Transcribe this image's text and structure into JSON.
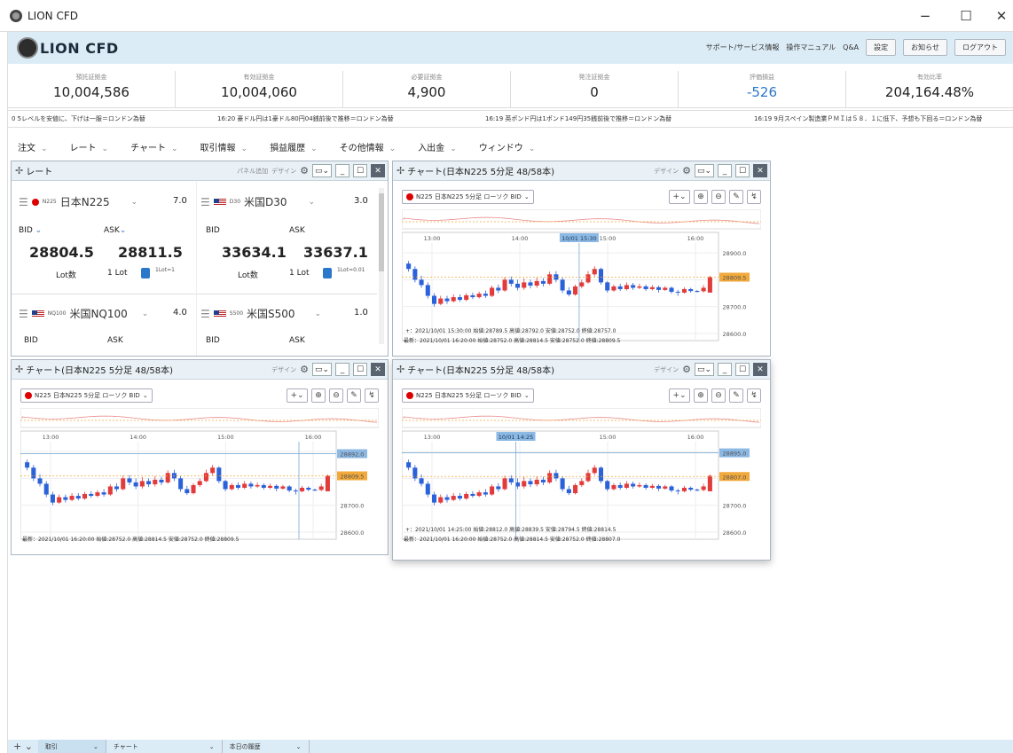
{
  "window": {
    "title": "LION CFD",
    "minimize": "−",
    "maximize": "☐",
    "close": "✕"
  },
  "header": {
    "brand": "LION CFD",
    "links": [
      "サポート/サービス情報",
      "操作マニュアル",
      "Q&A"
    ],
    "buttons": [
      "設定",
      "お知らせ",
      "ログアウト"
    ]
  },
  "summary": [
    {
      "label": "預託証拠金",
      "value": "10,004,586"
    },
    {
      "label": "有効証拠金",
      "value": "10,004,060"
    },
    {
      "label": "必要証拠金",
      "value": "4,900"
    },
    {
      "label": "発注証拠金",
      "value": "0"
    },
    {
      "label": "評価損益",
      "value": "-526"
    },
    {
      "label": "有効比率",
      "value": "204,164.48%"
    }
  ],
  "news": [
    "0 5レベルを安値に、下げは一服＝ロンドン為替",
    "16:20 豪ドル円は1豪ドル80円04銭前後で推移＝ロンドン為替",
    "16:19 英ポンド円は1ポンド149円35銭前後で推移＝ロンドン為替",
    "16:19 9月スペイン製造業ＰＭＩは５８．１に低下、予想も下回る＝ロンドン為替"
  ],
  "menu": [
    "注文",
    "レート",
    "チャート",
    "取引情報",
    "損益履歴",
    "その他情報",
    "入出金",
    "ウィンドウ"
  ],
  "rate_panel": {
    "title": "レート",
    "add_label": "パネル追加",
    "design_label": "デザイン",
    "cells": [
      {
        "code": "N225",
        "name": "日本N225",
        "spread": "7.0",
        "bid_label": "BID",
        "ask_label": "ASK",
        "bid": "28804.5",
        "ask": "28811.5",
        "lot_label": "Lot数",
        "lot": "1 Lot",
        "lot_unit": "1Lot=",
        "lot_unit_val": "1",
        "flag": "jp"
      },
      {
        "code": "D30",
        "name": "米国D30",
        "spread": "3.0",
        "bid_label": "BID",
        "ask_label": "ASK",
        "bid": "33634.1",
        "ask": "33637.1",
        "lot_label": "Lot数",
        "lot": "1 Lot",
        "lot_unit": "1Lot=",
        "lot_unit_val": "0.01",
        "flag": "us"
      },
      {
        "code": "NQ100",
        "name": "米国NQ100",
        "spread": "4.0",
        "bid_label": "BID",
        "ask_label": "ASK",
        "flag": "us"
      },
      {
        "code": "S500",
        "name": "米国S500",
        "spread": "1.0",
        "bid_label": "BID",
        "ask_label": "ASK",
        "flag": "us"
      }
    ]
  },
  "charts": [
    {
      "title": "チャート(日本N225 5分足 48/58本)",
      "design_label": "デザイン",
      "symbol_select": "N225 日本N225  5分足 ローソク BID",
      "times": [
        "13:00",
        "14:00",
        "15:00",
        "16:00"
      ],
      "cursor_time": "10/01 15:30",
      "prices": [
        "28900.0",
        "28809.5",
        "28700.0",
        "28600.0"
      ],
      "current_price": "28809.5",
      "crosshair_info": "+：2021/10/01 15:30:00 始値:28789.5 高値:28792.0 安値:28752.0 終値:28757.0",
      "latest_info": "最新：2021/10/01 16:20:00 始値:28752.0 高値:28814.5 安値:28752.0 終値:28809.5"
    },
    {
      "title": "チャート(日本N225 5分足 48/58本)",
      "design_label": "デザイン",
      "symbol_select": "N225 日本N225  5分足 ローソク BID",
      "times": [
        "13:00",
        "14:00",
        "15:00",
        "16:00"
      ],
      "prices": [
        "28892.0",
        "28809.5",
        "28700.0",
        "28600.0"
      ],
      "current_price": "28809.5",
      "line_price": "28892.0",
      "latest_info": "最新：2021/10/01 16:20:00 始値:28752.0 高値:28814.5 安値:28752.0 終値:28809.5"
    },
    {
      "title": "チャート(日本N225 5分足 48/58本)",
      "design_label": "デザイン",
      "symbol_select": "N225 日本N225  5分足 ローソク BID",
      "times": [
        "13:00",
        "14:",
        "15:00",
        "16:00"
      ],
      "cursor_time": "10/01 14:25",
      "prices": [
        "28895.0",
        "28807.0",
        "28700.0",
        "28600.0"
      ],
      "current_price": "28807.0",
      "line_price": "28895.0",
      "crosshair_info": "+：2021/10/01 14:25:00 始値:28812.0 高値:28839.5 安値:28794.5 終値:28814.5",
      "latest_info": "最新：2021/10/01 16:20:00 始値:28752.0 高値:28814.5 安値:28752.0 終値:28807.0"
    }
  ],
  "bottom_tabs": [
    "取引",
    "チャート",
    "本日の履歴"
  ],
  "colors": {
    "up": "#e23b3b",
    "down": "#2b62d9",
    "accent": "#2b77c9",
    "header_bg": "#dcecf6"
  },
  "candles": [
    {
      "o": 28860,
      "c": 28840,
      "h": 28870,
      "l": 28830
    },
    {
      "o": 28840,
      "c": 28800,
      "h": 28850,
      "l": 28790
    },
    {
      "o": 28800,
      "c": 28780,
      "h": 28815,
      "l": 28770
    },
    {
      "o": 28780,
      "c": 28740,
      "h": 28790,
      "l": 28730
    },
    {
      "o": 28740,
      "c": 28710,
      "h": 28750,
      "l": 28700
    },
    {
      "o": 28710,
      "c": 28730,
      "h": 28740,
      "l": 28705
    },
    {
      "o": 28730,
      "c": 28720,
      "h": 28740,
      "l": 28710
    },
    {
      "o": 28720,
      "c": 28735,
      "h": 28745,
      "l": 28715
    },
    {
      "o": 28735,
      "c": 28725,
      "h": 28745,
      "l": 28718
    },
    {
      "o": 28725,
      "c": 28742,
      "h": 28750,
      "l": 28720
    },
    {
      "o": 28742,
      "c": 28735,
      "h": 28752,
      "l": 28728
    },
    {
      "o": 28735,
      "c": 28748,
      "h": 28756,
      "l": 28730
    },
    {
      "o": 28748,
      "c": 28740,
      "h": 28760,
      "l": 28732
    },
    {
      "o": 28740,
      "c": 28770,
      "h": 28778,
      "l": 28735
    },
    {
      "o": 28770,
      "c": 28760,
      "h": 28782,
      "l": 28750
    },
    {
      "o": 28760,
      "c": 28800,
      "h": 28810,
      "l": 28755
    },
    {
      "o": 28800,
      "c": 28785,
      "h": 28812,
      "l": 28775
    },
    {
      "o": 28785,
      "c": 28770,
      "h": 28800,
      "l": 28760
    },
    {
      "o": 28770,
      "c": 28790,
      "h": 28805,
      "l": 28762
    },
    {
      "o": 28790,
      "c": 28778,
      "h": 28800,
      "l": 28768
    },
    {
      "o": 28778,
      "c": 28795,
      "h": 28808,
      "l": 28770
    },
    {
      "o": 28795,
      "c": 28785,
      "h": 28806,
      "l": 28775
    },
    {
      "o": 28785,
      "c": 28820,
      "h": 28830,
      "l": 28780
    },
    {
      "o": 28820,
      "c": 28800,
      "h": 28832,
      "l": 28790
    },
    {
      "o": 28800,
      "c": 28760,
      "h": 28808,
      "l": 28750
    },
    {
      "o": 28760,
      "c": 28745,
      "h": 28772,
      "l": 28738
    },
    {
      "o": 28745,
      "c": 28775,
      "h": 28782,
      "l": 28740
    },
    {
      "o": 28775,
      "c": 28790,
      "h": 28800,
      "l": 28768
    },
    {
      "o": 28790,
      "c": 28820,
      "h": 28832,
      "l": 28785
    },
    {
      "o": 28820,
      "c": 28840,
      "h": 28850,
      "l": 28812
    },
    {
      "o": 28840,
      "c": 28790,
      "h": 28845,
      "l": 28782
    },
    {
      "o": 28790,
      "c": 28760,
      "h": 28795,
      "l": 28752
    },
    {
      "o": 28760,
      "c": 28775,
      "h": 28782,
      "l": 28755
    },
    {
      "o": 28775,
      "c": 28765,
      "h": 28785,
      "l": 28758
    },
    {
      "o": 28765,
      "c": 28780,
      "h": 28790,
      "l": 28760
    },
    {
      "o": 28780,
      "c": 28770,
      "h": 28788,
      "l": 28762
    },
    {
      "o": 28770,
      "c": 28775,
      "h": 28785,
      "l": 28765
    },
    {
      "o": 28775,
      "c": 28765,
      "h": 28782,
      "l": 28758
    },
    {
      "o": 28765,
      "c": 28772,
      "h": 28780,
      "l": 28760
    },
    {
      "o": 28772,
      "c": 28762,
      "h": 28778,
      "l": 28752
    },
    {
      "o": 28762,
      "c": 28770,
      "h": 28776,
      "l": 28758
    },
    {
      "o": 28770,
      "c": 28755,
      "h": 28775,
      "l": 28748
    },
    {
      "o": 28755,
      "c": 28752,
      "h": 28762,
      "l": 28740
    },
    {
      "o": 28752,
      "c": 28765,
      "h": 28772,
      "l": 28748
    },
    {
      "o": 28765,
      "c": 28758,
      "h": 28770,
      "l": 28752
    },
    {
      "o": 28758,
      "c": 28757,
      "h": 28762,
      "l": 28752
    },
    {
      "o": 28757,
      "c": 28770,
      "h": 28780,
      "l": 28752
    },
    {
      "o": 28752,
      "c": 28809.5,
      "h": 28814.5,
      "l": 28752
    }
  ]
}
